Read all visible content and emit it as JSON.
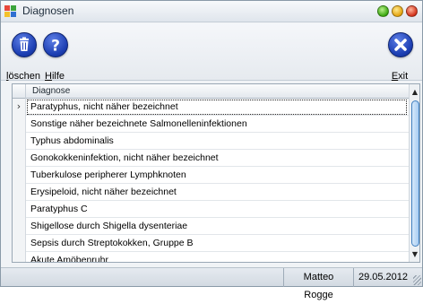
{
  "window": {
    "title": "Diagnosen"
  },
  "toolbar": {
    "delete": {
      "label_prefix": "",
      "label_accel": "l",
      "label_rest": "öschen",
      "icon": "trash-icon"
    },
    "help": {
      "label_prefix": "",
      "label_accel": "H",
      "label_rest": "ilfe",
      "icon": "question-icon"
    },
    "exit": {
      "label_prefix": "",
      "label_accel": "E",
      "label_rest": "xit",
      "icon": "close-icon"
    }
  },
  "grid": {
    "column_header": "Diagnose",
    "selected_index": 0,
    "rows": [
      "Paratyphus, nicht näher bezeichnet",
      "Sonstige näher bezeichnete Salmonelleninfektionen",
      "Typhus abdominalis",
      "Gonokokkeninfektion, nicht näher bezeichnet",
      "Tuberkulose peripherer Lymphknoten",
      "Erysipeloid, nicht näher bezeichnet",
      "Paratyphus C",
      "Shigellose durch Shigella dysenteriae",
      "Sepsis durch Streptokokken, Gruppe B",
      "Akute Amöbenruhr"
    ]
  },
  "status": {
    "user": "Matteo Rogge",
    "date": "29.05.2012"
  },
  "colors": {
    "icon_blue": "#1d3fb3",
    "selection_border": "#222222",
    "scroll_thumb": "#a9cdf2"
  }
}
